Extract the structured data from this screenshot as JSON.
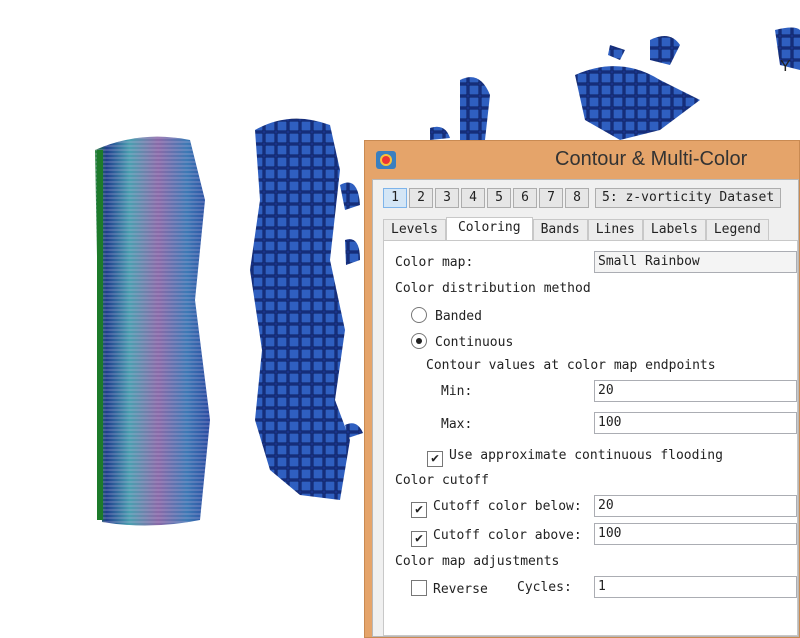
{
  "viz": {
    "axis_label": "Y"
  },
  "dialog": {
    "title": "Contour & Multi-Color",
    "dataset_numbers": [
      "1",
      "2",
      "3",
      "4",
      "5",
      "6",
      "7",
      "8"
    ],
    "selected_number": "1",
    "dataset_select": "5: z-vorticity Dataset",
    "tabs": [
      "Levels",
      "Coloring",
      "Bands",
      "Lines",
      "Labels",
      "Legend"
    ],
    "active_tab": "Coloring",
    "color_map_label": "Color map:",
    "color_map_value": "Small Rainbow",
    "distribution_heading": "Color distribution method",
    "banded_label": "Banded",
    "continuous_label": "Continuous",
    "selected_distribution": "Continuous",
    "endpoints_heading": "Contour values at color map endpoints",
    "min_label": "Min:",
    "min_value": "20",
    "max_label": "Max:",
    "max_value": "100",
    "approx_flooding_label": "Use approximate continuous flooding",
    "approx_flooding_checked": true,
    "cutoff_heading": "Color cutoff",
    "cutoff_below_label": "Cutoff color below:",
    "cutoff_below_checked": true,
    "cutoff_below_value": "20",
    "cutoff_above_label": "Cutoff color above:",
    "cutoff_above_checked": true,
    "cutoff_above_value": "100",
    "adjust_heading": "Color map adjustments",
    "reverse_label": "Reverse",
    "reverse_checked": false,
    "cycles_label": "Cycles:",
    "cycles_value": "1"
  },
  "colors": {
    "title_bar": "#e5a46a",
    "panel": "#f0f0f0",
    "selected_tab_bg": "#ffffff"
  }
}
